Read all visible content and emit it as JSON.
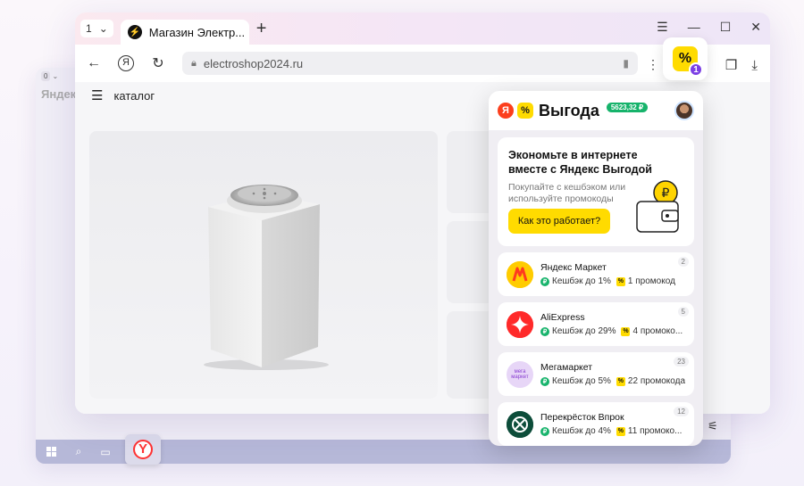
{
  "back_window": {
    "tab_count": "0",
    "title": "Яндекс"
  },
  "browser": {
    "tab_counter": "1",
    "tab_title": "Магазин Электр...",
    "new_tab": "+",
    "url": "electroshop2024.ru",
    "catalog_label": "каталог"
  },
  "extension": {
    "badge": "1",
    "logo": "%"
  },
  "popup": {
    "title": "Выгода",
    "balance": "5623,32 ₽",
    "headline": "Экономьте в интернете вместе с Яндекс Выгодой",
    "subtext": "Покупайте с кешбэком или используйте промокоды",
    "button_label": "Как это работает?",
    "shops": [
      {
        "name": "Яндекс Маркет",
        "cashback": "Кешбэк до 1%",
        "promos": "1 промокод",
        "count": "2",
        "color": "#ffcc00"
      },
      {
        "name": "AliExpress",
        "cashback": "Кешбэк до 29%",
        "promos": "4 промоко...",
        "count": "5",
        "color": "#ff2a2a"
      },
      {
        "name": "Мегамаркет",
        "cashback": "Кешбэк до 5%",
        "promos": "22 промокода",
        "count": "23",
        "color": "#e7d6f7"
      },
      {
        "name": "Перекрёсток Впрок",
        "cashback": "Кешбэк до 4%",
        "promos": "11 промоко...",
        "count": "12",
        "color": "#0d4d3a"
      }
    ],
    "shop_logo_text": {
      "megamarket": "мега маркет"
    }
  }
}
